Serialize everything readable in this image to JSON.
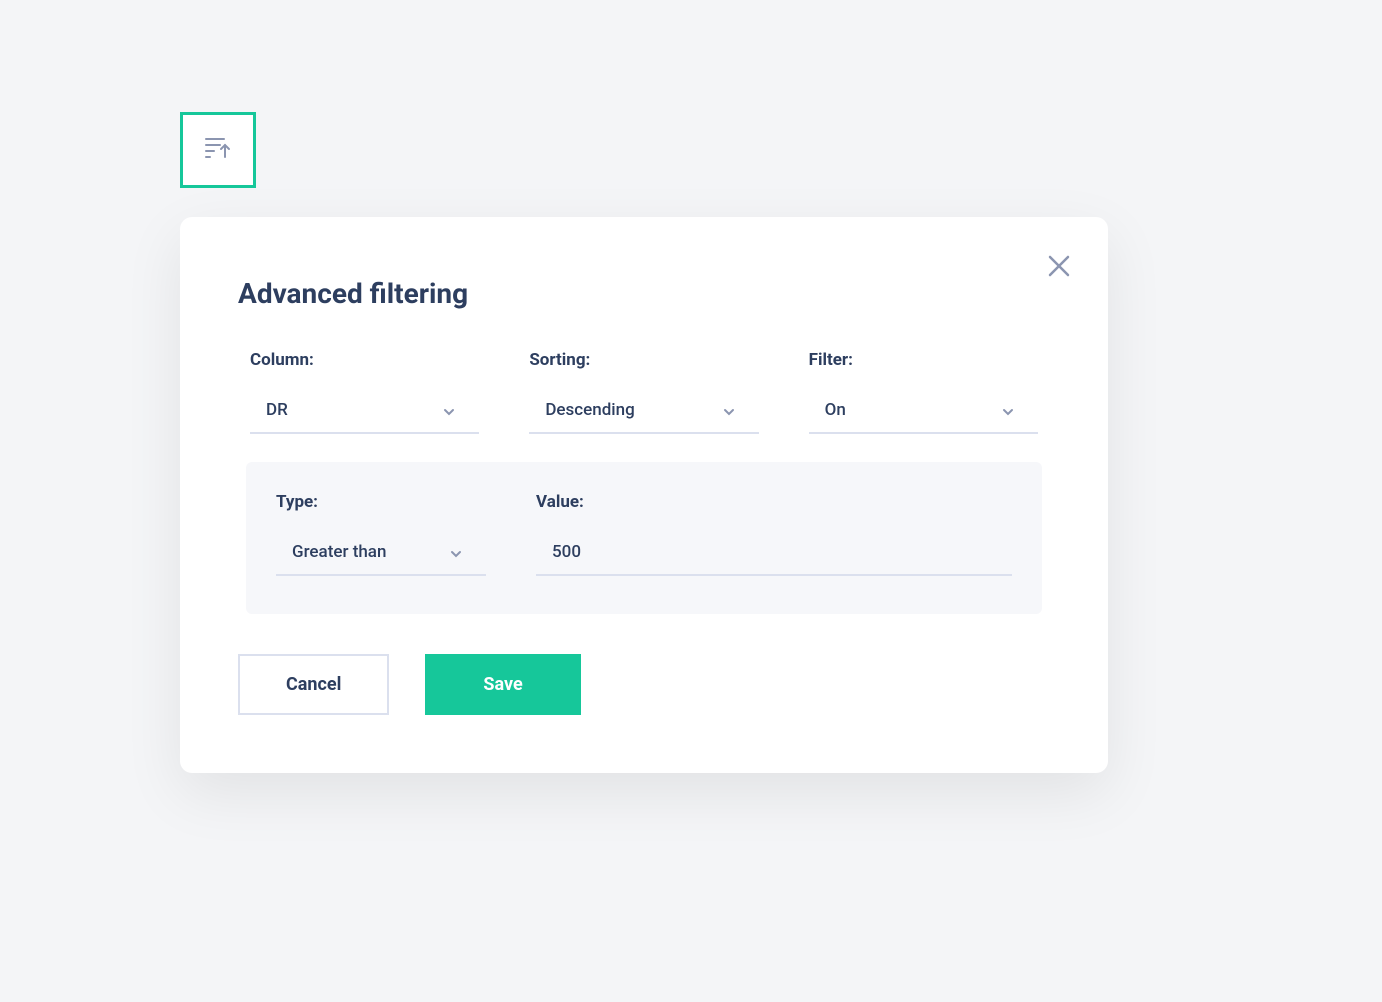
{
  "modal": {
    "title": "Advanced filtering",
    "fields": {
      "column": {
        "label": "Column:",
        "value": "DR"
      },
      "sorting": {
        "label": "Sorting:",
        "value": "Descending"
      },
      "filter": {
        "label": "Filter:",
        "value": "On"
      },
      "type": {
        "label": "Type:",
        "value": "Greater than"
      },
      "filterValue": {
        "label": "Value:",
        "value": "500"
      }
    },
    "buttons": {
      "cancel": "Cancel",
      "save": "Save"
    }
  },
  "colors": {
    "accent": "#16c79a",
    "text": "#2d3e5f",
    "muted": "#8b95b0",
    "border": "#dbe0ee"
  }
}
